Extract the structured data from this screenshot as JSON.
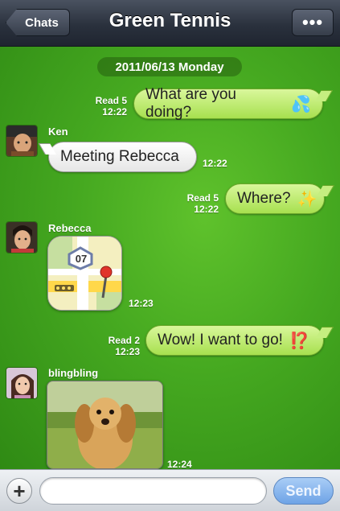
{
  "header": {
    "back_label": "Chats",
    "title": "Green Tennis",
    "more_label": "•••"
  },
  "chat": {
    "date": "2011/06/13 Monday",
    "messages": [
      {
        "direction": "out",
        "text": "What are you doing?",
        "emoji": "💦",
        "read": "Read 5",
        "time": "12:22"
      },
      {
        "direction": "in",
        "sender": "Ken",
        "text": "Meeting Rebecca",
        "time": "12:22"
      },
      {
        "direction": "out",
        "text": "Where?",
        "emoji": "✨",
        "read": "Read 5",
        "time": "12:22"
      },
      {
        "direction": "in",
        "sender": "Rebecca",
        "attachment": "maps-app-icon",
        "map_number": "07",
        "time": "12:23"
      },
      {
        "direction": "out",
        "text": "Wow! I want to go!",
        "emoji": "⁉️",
        "read": "Read 2",
        "time": "12:23"
      },
      {
        "direction": "in",
        "sender": "blingbling",
        "attachment": "dog-photo",
        "time": "12:24"
      }
    ]
  },
  "input": {
    "placeholder": "",
    "send_label": "Send",
    "plus_label": "+"
  },
  "colors": {
    "chat_background": "#45a820",
    "outgoing_bubble": "#b6e766",
    "incoming_bubble": "#ffffff",
    "send_button": "#7aaeea"
  }
}
